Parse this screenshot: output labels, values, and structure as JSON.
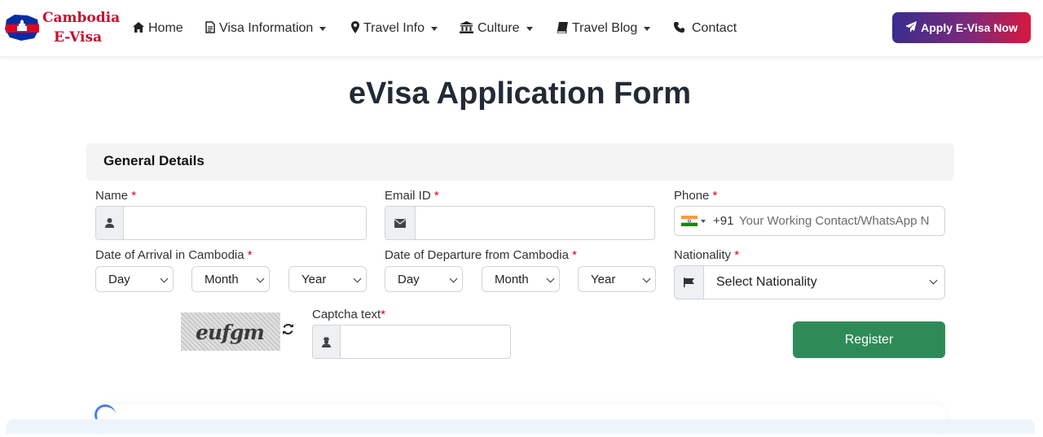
{
  "header": {
    "logo_line1": "Cambodia",
    "logo_line2": "E-Visa",
    "nav": [
      {
        "label": "Home",
        "icon": "home-icon",
        "dropdown": false
      },
      {
        "label": "Visa Information",
        "icon": "file-icon",
        "dropdown": true
      },
      {
        "label": "Travel Info",
        "icon": "map-marker-icon",
        "dropdown": true
      },
      {
        "label": "Culture",
        "icon": "landmark-icon",
        "dropdown": true
      },
      {
        "label": "Travel Blog",
        "icon": "book-icon",
        "dropdown": true
      },
      {
        "label": "Contact",
        "icon": "phone-icon",
        "dropdown": false
      }
    ],
    "apply_label": "Apply E-Visa Now"
  },
  "page_title": "eVisa Application Form",
  "section_title": "General Details",
  "form": {
    "name_label": "Name",
    "email_label": "Email ID",
    "phone_label": "Phone",
    "phone_dial_code": "+91",
    "phone_placeholder": "Your Working Contact/WhatsApp N",
    "arrival_label": "Date of Arrival in Cambodia",
    "departure_label": "Date of Departure from Cambodia",
    "day": "Day",
    "month": "Month",
    "year": "Year",
    "nationality_label": "Nationality",
    "nationality_value": "Select Nationality",
    "captcha_text_label": "Captcha text",
    "captcha_image_text": "eufgm",
    "required_mark": "*",
    "register_label": "Register"
  },
  "colors": {
    "accent_green": "#2e8b57",
    "required_red": "#d0021b",
    "brand_red": "#c8102e"
  }
}
